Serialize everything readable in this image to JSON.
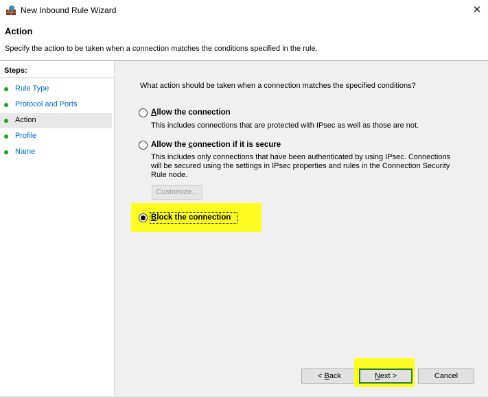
{
  "window": {
    "title": "New Inbound Rule Wizard",
    "icon": "firewall-icon",
    "close_glyph": "✕"
  },
  "header": {
    "title": "Action",
    "description": "Specify the action to be taken when a connection matches the conditions specified in the rule."
  },
  "sidebar": {
    "steps_label": "Steps:",
    "items": [
      {
        "label": "Rule Type"
      },
      {
        "label": "Protocol and Ports"
      },
      {
        "label": "Action"
      },
      {
        "label": "Profile"
      },
      {
        "label": "Name"
      }
    ],
    "current_index": 2
  },
  "content": {
    "question": "What action should be taken when a connection matches the specified conditions?",
    "options": [
      {
        "label_pre": "",
        "label_ul": "A",
        "label_post": "llow the connection",
        "description": "This includes connections that are protected with IPsec as well as those are not.",
        "checked": false
      },
      {
        "label_pre": "Allow the ",
        "label_ul": "c",
        "label_post": "onnection if it is secure",
        "description": "This includes only connections that have been authenticated by using IPsec.  Connections will be secured using the settings in IPsec properties and rules in the Connection Security Rule node.",
        "checked": false
      },
      {
        "label_pre": "",
        "label_ul": "B",
        "label_post": "lock the connection",
        "description": "",
        "checked": true
      }
    ],
    "customize_label": "Customize..."
  },
  "footer": {
    "back": {
      "pre": "< ",
      "ul": "B",
      "post": "ack"
    },
    "next": {
      "pre": "",
      "ul": "N",
      "post": "ext >"
    },
    "cancel": "Cancel"
  },
  "colors": {
    "highlight": "#ffff00",
    "step_link": "#0066cc",
    "step_dot": "#1ea51e",
    "default_button_border": "#2e7d32"
  }
}
